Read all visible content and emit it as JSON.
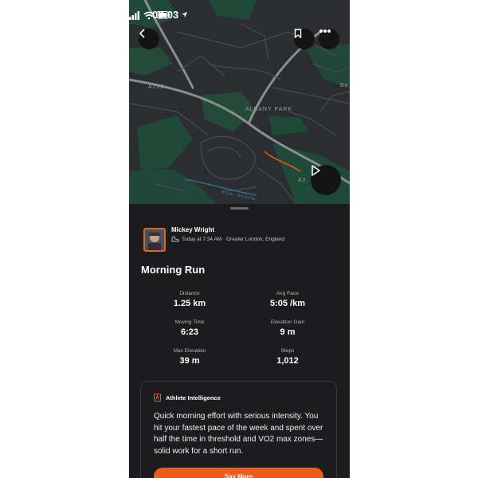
{
  "status_bar": {
    "time": "08:03"
  },
  "map": {
    "labels": {
      "road_a222": "A222",
      "area": "ALBANY PARK",
      "road_a2": "A2",
      "river": "River Shuttle",
      "edge": "Be"
    }
  },
  "activity": {
    "athlete": {
      "name": "Mickey Wright",
      "meta": "Today at 7:34 AM · Greater London, England"
    },
    "title": "Morning Run",
    "stats": [
      {
        "label": "Distance",
        "value": "1.25 km"
      },
      {
        "label": "Avg Pace",
        "value": "5:05 /km"
      },
      {
        "label": "Moving Time",
        "value": "6:23"
      },
      {
        "label": "Elevation Gain",
        "value": "9 m"
      },
      {
        "label": "Max Elevation",
        "value": "39 m"
      },
      {
        "label": "Steps",
        "value": "1,012"
      }
    ],
    "athlete_intelligence": {
      "title": "Athlete Intelligence",
      "text": "Quick morning effort with serious intensity. You hit your fastest pace of the week and spent over half the time in threshold and VO2 max zones—solid work for a short run.",
      "button_label": "Say More"
    }
  },
  "colors": {
    "accent": "#f05a1a",
    "sheet_bg": "#1c1c1e",
    "map_bg": "#2b2d30",
    "park_green": "#1f4a3a"
  },
  "icons": {
    "status": [
      "location-arrow-icon",
      "signal-icon",
      "wifi-icon",
      "battery-icon"
    ],
    "map_buttons": [
      "back-chevron-icon",
      "bookmark-icon",
      "more-icon",
      "play-icon"
    ],
    "meta": "shoe-icon",
    "ai": "athlete-intelligence-icon"
  }
}
